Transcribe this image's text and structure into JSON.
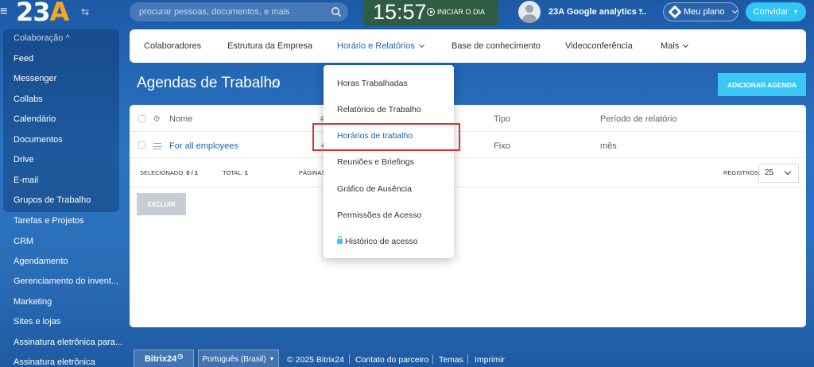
{
  "topbar": {
    "logo_text": "23",
    "logo_accent": "A",
    "search_placeholder": "procurar pessoas, documentos, e mais",
    "clock": "15:57",
    "start_day": "INICIAR O DIA",
    "user_name": "23A Google analytics ...",
    "plan_label": "Meu plano",
    "invite_label": "Convidar"
  },
  "sidebar": {
    "group_title": "Colaboração ^",
    "items": [
      "Feed",
      "Messenger",
      "Collabs",
      "Calendário",
      "Documentos",
      "Drive",
      "E-mail",
      "Grupos de Trabalho",
      "Tarefas e Projetos",
      "CRM",
      "Agendamento",
      "Gerenciamento do invent...",
      "Marketing",
      "Sites e lojas",
      "Assinatura eletrônica para...",
      "Assinatura eletrônica"
    ]
  },
  "nav": {
    "tabs": [
      "Colaboradores",
      "Estrutura da Empresa",
      "Horário e Relatórios",
      "Base de conhecimento",
      "Videoconferência",
      "Mais"
    ]
  },
  "page": {
    "title": "Agendas de Trabalho",
    "add_button": "ADICIONAR AGENDA"
  },
  "table": {
    "headers": {
      "name": "Nome",
      "hash": "#",
      "type": "Tipo",
      "period": "Período de relatório"
    },
    "rows": [
      {
        "name": "For all employees",
        "marker": "+",
        "type": "Fixo",
        "period": "mês"
      }
    ],
    "footer": {
      "selected_label": "SELECIONADO:",
      "selected_value": "0 / 1",
      "total_label": "TOTAL:",
      "total_value": "1",
      "pages_label": "PÁGINAS",
      "records_label": "REGISTROS:",
      "records_value": "25"
    },
    "delete_button": "EXCLUIR"
  },
  "dropdown": {
    "items": [
      "Horas Trabalhadas",
      "Relatórios de Trabalho",
      "Horários de trabalho",
      "Reuniões e Briefings",
      "Gráfico de Ausência",
      "Permissões de Acesso",
      "Histórico de acesso"
    ],
    "selected_index": 2
  },
  "footer": {
    "brand": "Bitrix24",
    "language": "Português (Brasil)",
    "copyright": "© 2025 Bitrix24",
    "links": [
      "Contato do parceiro",
      "Temas",
      "Imprimir"
    ]
  },
  "colors": {
    "accent": "#2fc6f6",
    "link": "#2067b0",
    "clock_bg": "#2f5d43",
    "highlight": "#d7303b"
  }
}
